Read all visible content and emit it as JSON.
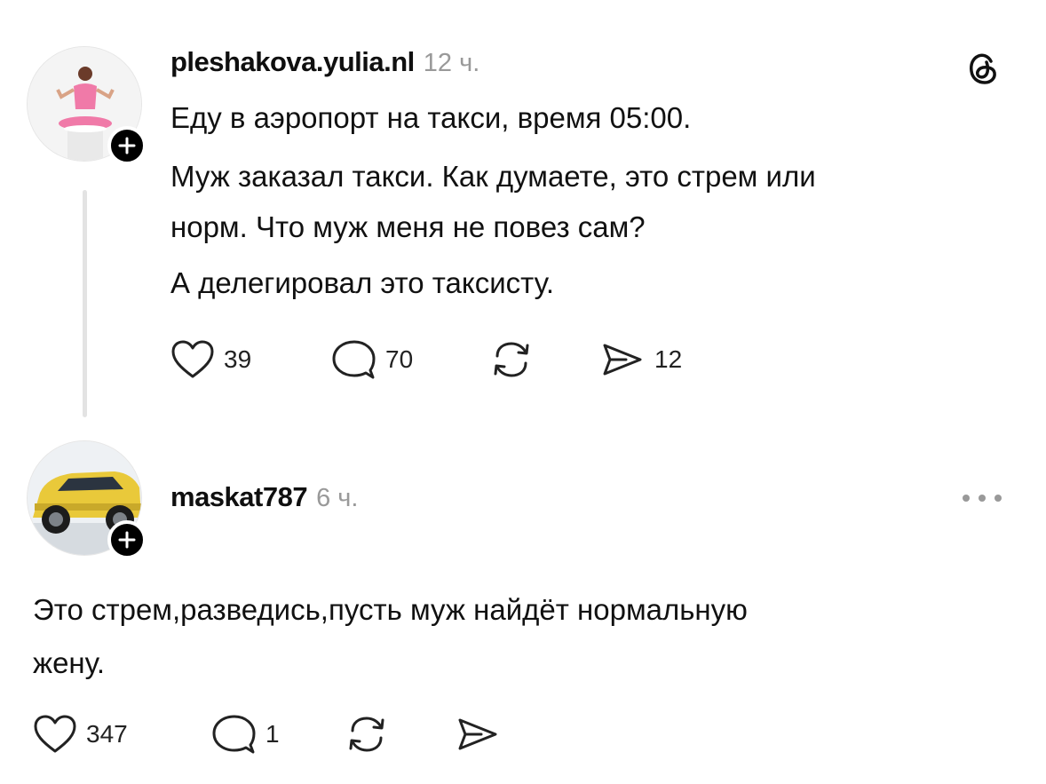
{
  "post": {
    "username": "pleshakova.yulia.nl",
    "time": "12 ч.",
    "lines": [
      "Еду в аэропорт на такси, время 05:00.",
      "Муж заказал такси. Как думаете, это стрем или",
      "норм. Что муж меня не повез сам?",
      "А делегировал это таксисту."
    ],
    "likes": "39",
    "replies": "70",
    "shares": "12",
    "app_icon": "threads-logo-icon"
  },
  "reply": {
    "username": "maskat787",
    "time": "6 ч.",
    "lines": [
      "Это стрем,разведись,пусть муж найдёт нормальную",
      "жену."
    ],
    "likes": "347",
    "replies": "1"
  },
  "colors": {
    "accent_yellow": "#e9c93a",
    "avatar_pink": "#f07aa8",
    "muted": "#999999"
  }
}
